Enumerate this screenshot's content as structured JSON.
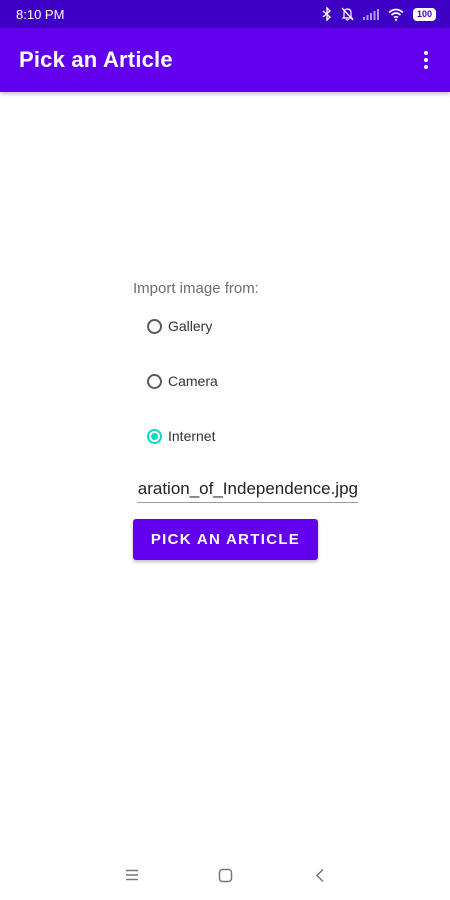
{
  "status_bar": {
    "time": "8:10 PM",
    "battery": "100",
    "icons": [
      "bluetooth-icon",
      "mute-icon",
      "signal-icon",
      "wifi-icon",
      "battery-icon"
    ]
  },
  "app_bar": {
    "title": "Pick an Article",
    "menu_icon": "more-vert-icon"
  },
  "form": {
    "import_label": "Import image from:",
    "options": [
      {
        "label": "Gallery",
        "checked": false
      },
      {
        "label": "Camera",
        "checked": false
      },
      {
        "label": "Internet",
        "checked": true
      }
    ],
    "url_value": "Declaration_of_Independence.jpg",
    "button_label": "PICK AN ARTICLE"
  },
  "nav_bar": {
    "icons": [
      "menu-icon",
      "home-icon",
      "back-icon"
    ]
  },
  "colors": {
    "status_bar": "#3f00c4",
    "primary": "#6200ee",
    "accent": "#03dac5"
  }
}
